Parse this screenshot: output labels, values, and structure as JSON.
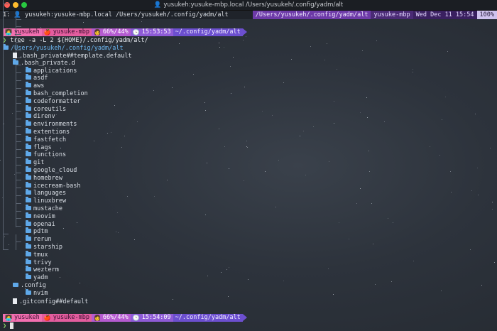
{
  "window": {
    "title": "yusukeh:yusuke-mbp.local /Users/yusukeh/.config/yadm/alt"
  },
  "tmux": {
    "window_index": "1:",
    "window_label": "yusukeh:yusuke-mbp.local /Users/yusukeh/.config/yadm/alt",
    "new_window": "+",
    "path": "/Users/yusukeh/.config/yadm/alt",
    "host": "yusuke-mbp",
    "date": "Wed Dec 11 15:54",
    "percent": "100%"
  },
  "prompt1": {
    "user": "yusukeh",
    "host": "yusuke-mbp",
    "battery": "66%/44%",
    "time": "15:53:53",
    "dir": "~/.config/yadm/alt"
  },
  "command": {
    "caret": "❯",
    "text": "tree -a -L 2 ${HOME}/.config/yadm/alt/"
  },
  "tree": {
    "root": "/Users/yusukeh/.config/yadm/alt",
    "entries": [
      {
        "name": ".bash_private##template.default",
        "kind": "file"
      },
      {
        "name": ".bash_private.d",
        "kind": "folder"
      },
      {
        "name": "applications",
        "kind": "folder"
      },
      {
        "name": "asdf",
        "kind": "folder"
      },
      {
        "name": "aws",
        "kind": "folder"
      },
      {
        "name": "bash_completion",
        "kind": "folder"
      },
      {
        "name": "codeformatter",
        "kind": "folder"
      },
      {
        "name": "coreutils",
        "kind": "folder"
      },
      {
        "name": "direnv",
        "kind": "folder"
      },
      {
        "name": "environments",
        "kind": "folder"
      },
      {
        "name": "extentions",
        "kind": "folder"
      },
      {
        "name": "fastfetch",
        "kind": "folder"
      },
      {
        "name": "flags",
        "kind": "folder"
      },
      {
        "name": "functions",
        "kind": "folder"
      },
      {
        "name": "git",
        "kind": "folder"
      },
      {
        "name": "google_cloud",
        "kind": "folder"
      },
      {
        "name": "homebrew",
        "kind": "folder"
      },
      {
        "name": "icecream-bash",
        "kind": "folder"
      },
      {
        "name": "languages",
        "kind": "folder"
      },
      {
        "name": "linuxbrew",
        "kind": "folder"
      },
      {
        "name": "mustache",
        "kind": "folder"
      },
      {
        "name": "neovim",
        "kind": "folder"
      },
      {
        "name": "openai",
        "kind": "folder"
      },
      {
        "name": "pdtm",
        "kind": "folder"
      },
      {
        "name": "rerun",
        "kind": "folder"
      },
      {
        "name": "starship",
        "kind": "folder"
      },
      {
        "name": "tmux",
        "kind": "folder"
      },
      {
        "name": "trivy",
        "kind": "folder"
      },
      {
        "name": "wezterm",
        "kind": "folder"
      },
      {
        "name": "yadm",
        "kind": "folder"
      },
      {
        "name": ".config",
        "kind": "config-folder"
      },
      {
        "name": "nvim",
        "kind": "folder"
      },
      {
        "name": ".gitconfig##default",
        "kind": "file"
      }
    ]
  },
  "prompt2": {
    "user": "yusukeh",
    "host": "yusuke-mbp",
    "battery": "66%/44%",
    "time": "15:54:09",
    "dir": "~/.config/yadm/alt"
  },
  "colors": {
    "folder": "#5fa8e8",
    "prompt_pink": "#f26fb0",
    "prompt_purple": "#6c4fcf",
    "caret_green": "#8bd86b"
  }
}
